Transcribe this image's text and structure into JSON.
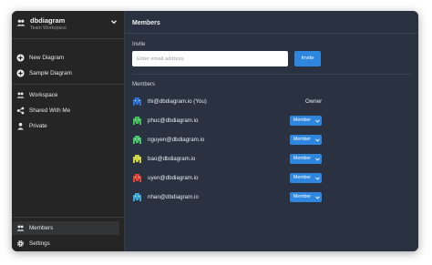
{
  "workspace": {
    "name": "dbdiagram",
    "subtitle": "Team Workspace"
  },
  "sidebar": {
    "top_items": [
      {
        "label": "New Diagram",
        "icon": "plus-circle-icon"
      },
      {
        "label": "Sample Diagram",
        "icon": "plus-circle-icon"
      }
    ],
    "mid_items": [
      {
        "label": "Workspace",
        "icon": "users-icon"
      },
      {
        "label": "Shared With Me",
        "icon": "share-icon"
      },
      {
        "label": "Private",
        "icon": "person-icon"
      }
    ],
    "bottom_items": [
      {
        "label": "Members",
        "icon": "users-icon",
        "active": true
      },
      {
        "label": "Settings",
        "icon": "gear-icon",
        "active": false
      }
    ]
  },
  "main": {
    "title": "Members",
    "invite": {
      "label": "Invite",
      "placeholder": "Enter email address",
      "button_label": "Invite"
    },
    "members_label": "Members",
    "members": [
      {
        "email": "thi@dbdiagram.io (You)",
        "role": "Owner",
        "avatar_color": "#2f6fd8"
      },
      {
        "email": "phuc@dbdiagram.io",
        "role": "Member",
        "avatar_color": "#3fbf58"
      },
      {
        "email": "nguyen@dbdiagram.io",
        "role": "Member",
        "avatar_color": "#45c26a"
      },
      {
        "email": "bao@dbdiagram.io",
        "role": "Member",
        "avatar_color": "#c9d23a"
      },
      {
        "email": "uyen@dbdiagram.io",
        "role": "Member",
        "avatar_color": "#e0453a"
      },
      {
        "email": "nhan@dbdiagram.io",
        "role": "Member",
        "avatar_color": "#39a9d8"
      }
    ]
  },
  "colors": {
    "accent": "#2e86de",
    "sidebar_bg": "#252526",
    "main_bg": "#2a3140"
  }
}
